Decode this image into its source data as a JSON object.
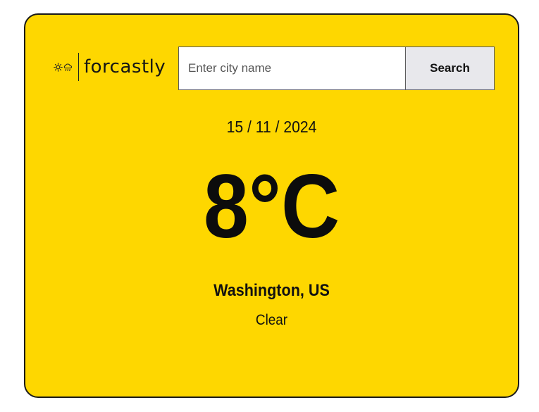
{
  "app": {
    "logo_text": "forcastly",
    "logo_icons": [
      "sun-icon",
      "cloud-rain-icon"
    ]
  },
  "search": {
    "placeholder": "Enter city name",
    "value": "",
    "button_label": "Search"
  },
  "weather": {
    "date": "15 / 11 / 2024",
    "temperature": "8°C",
    "location": "Washington, US",
    "condition": "Clear"
  },
  "colors": {
    "card_background": "#FED700",
    "border": "#1a1a1a",
    "button_background": "#e8e8ec"
  }
}
